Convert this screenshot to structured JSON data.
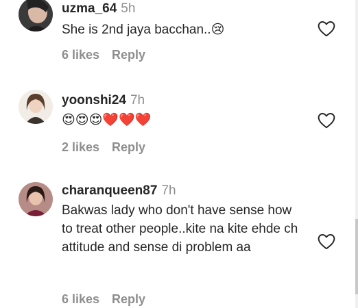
{
  "comments": [
    {
      "username": "uzma_64",
      "time": "5h",
      "text": "She is 2nd jaya bacchan..😢",
      "likes": "6 likes",
      "reply": "Reply"
    },
    {
      "username": "yoonshi24",
      "time": "7h",
      "text": "😍😍😍❤️❤️❤️",
      "likes": "2 likes",
      "reply": "Reply"
    },
    {
      "username": "charanqueen87",
      "time": "7h",
      "text": "Bakwas lady who don't have sense how to treat other people..kite na kite ehde ch attitude and sense di problem aa",
      "likes": "6 likes",
      "reply": "Reply"
    }
  ],
  "icons": {
    "like": "heart-outline-icon"
  }
}
